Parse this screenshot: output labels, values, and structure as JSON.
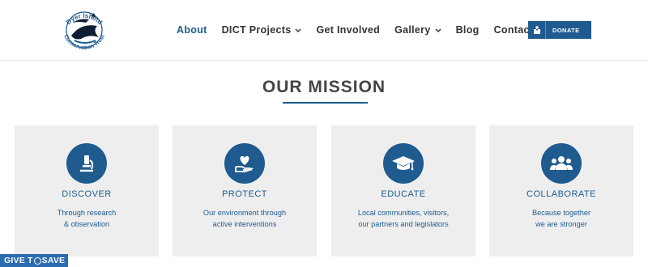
{
  "header": {
    "logo": {
      "line1": "Dyer Island",
      "line2": "Conservation Trust"
    },
    "nav": [
      {
        "label": "About",
        "active": true,
        "has_dropdown": false
      },
      {
        "label": "DICT Projects",
        "active": false,
        "has_dropdown": true
      },
      {
        "label": "Get Involved",
        "active": false,
        "has_dropdown": false
      },
      {
        "label": "Gallery",
        "active": false,
        "has_dropdown": true
      },
      {
        "label": "Blog",
        "active": false,
        "has_dropdown": false
      },
      {
        "label": "Contact",
        "active": false,
        "has_dropdown": false
      }
    ],
    "donate": {
      "label": "DONATE",
      "icon": "donation-box-icon"
    }
  },
  "mission": {
    "title": "OUR MISSION",
    "cards": [
      {
        "icon": "microscope-icon",
        "title": "DISCOVER",
        "line1": "Through research",
        "line2": "& observation"
      },
      {
        "icon": "heart-hand-icon",
        "title": "PROTECT",
        "line1": "Our environment through",
        "line2": "active interventions"
      },
      {
        "icon": "graduation-cap-icon",
        "title": "EDUCATE",
        "line1": "Local communities, visitors,",
        "line2": "our partners and legislators"
      },
      {
        "icon": "group-icon",
        "title": "COLLABORATE",
        "line1": "Because together",
        "line2": "we are stronger"
      }
    ]
  },
  "badge": {
    "part1": "GIVE T",
    "part2": " SAVE"
  },
  "colors": {
    "brand_blue": "#1f5b8f",
    "card_bg": "#eeeeee",
    "badge_blue": "#2b6cb0",
    "nav_text": "#333333"
  }
}
